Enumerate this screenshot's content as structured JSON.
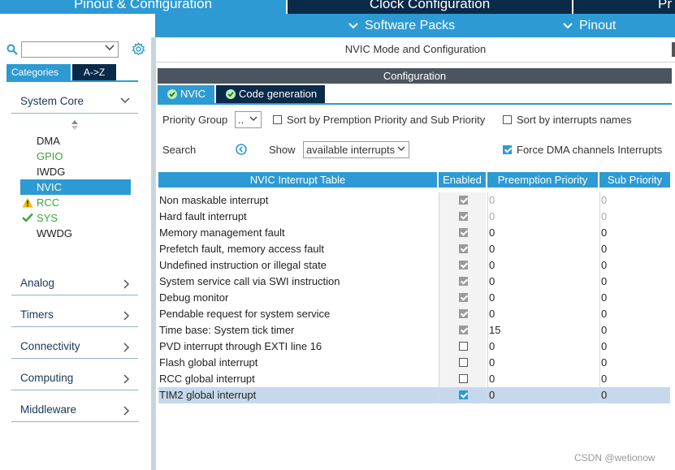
{
  "top_tabs": {
    "pinout": "Pinout & Configuration",
    "clock": "Clock Configuration",
    "project": "Pr"
  },
  "sub_bar": {
    "software_packs": "Software Packs",
    "pinout": "Pinout"
  },
  "left_panel": {
    "tabs": {
      "categories": "Categories",
      "atoz": "A->Z"
    },
    "system_core": {
      "label": "System Core",
      "items": [
        {
          "label": "DMA",
          "status": "none",
          "color": "#222222"
        },
        {
          "label": "GPIO",
          "status": "none",
          "color": "#3aa63a"
        },
        {
          "label": "IWDG",
          "status": "none",
          "color": "#222222"
        },
        {
          "label": "NVIC",
          "status": "selected",
          "color": "#ffffff"
        },
        {
          "label": "RCC",
          "status": "warning",
          "color": "#3aa63a"
        },
        {
          "label": "SYS",
          "status": "ok",
          "color": "#3aa63a"
        },
        {
          "label": "WWDG",
          "status": "none",
          "color": "#222222"
        }
      ]
    },
    "groups": [
      "Analog",
      "Timers",
      "Connectivity",
      "Computing",
      "Middleware"
    ]
  },
  "right_panel": {
    "mode_title": "NVIC Mode and Configuration",
    "config_title": "Configuration",
    "subtabs": {
      "nvic": "NVIC",
      "code_generation": "Code generation"
    },
    "priority_group_label": "Priority Group",
    "priority_group_value": "..",
    "sort_premption_label": "Sort by Premption Priority and Sub Priority",
    "sort_names_label": "Sort by interrupts names",
    "search_label": "Search",
    "show_label": "Show",
    "show_value": "available interrupts",
    "force_dma_label": "Force DMA channels Interrupts",
    "force_dma_checked": true
  },
  "table": {
    "headers": {
      "name": "NVIC Interrupt Table",
      "enabled": "Enabled",
      "preemption": "Preemption Priority",
      "sub": "Sub Priority"
    },
    "rows": [
      {
        "name": "Non maskable interrupt",
        "enabled": true,
        "locked": true,
        "preemption": "0",
        "sub": "0",
        "dim": true
      },
      {
        "name": "Hard fault interrupt",
        "enabled": true,
        "locked": true,
        "preemption": "0",
        "sub": "0",
        "dim": true
      },
      {
        "name": "Memory management fault",
        "enabled": true,
        "locked": true,
        "preemption": "0",
        "sub": "0",
        "dim": false
      },
      {
        "name": "Prefetch fault, memory access fault",
        "enabled": true,
        "locked": true,
        "preemption": "0",
        "sub": "0",
        "dim": false
      },
      {
        "name": "Undefined instruction or illegal state",
        "enabled": true,
        "locked": true,
        "preemption": "0",
        "sub": "0",
        "dim": false
      },
      {
        "name": "System service call via SWI instruction",
        "enabled": true,
        "locked": true,
        "preemption": "0",
        "sub": "0",
        "dim": false
      },
      {
        "name": "Debug monitor",
        "enabled": true,
        "locked": true,
        "preemption": "0",
        "sub": "0",
        "dim": false
      },
      {
        "name": "Pendable request for system service",
        "enabled": true,
        "locked": true,
        "preemption": "0",
        "sub": "0",
        "dim": false
      },
      {
        "name": "Time base: System tick timer",
        "enabled": true,
        "locked": true,
        "preemption": "15",
        "sub": "0",
        "dim": false
      },
      {
        "name": "PVD interrupt through EXTI line 16",
        "enabled": false,
        "locked": false,
        "preemption": "0",
        "sub": "0",
        "dim": false
      },
      {
        "name": "Flash global interrupt",
        "enabled": false,
        "locked": false,
        "preemption": "0",
        "sub": "0",
        "dim": false
      },
      {
        "name": "RCC global interrupt",
        "enabled": false,
        "locked": false,
        "preemption": "0",
        "sub": "0",
        "dim": false
      },
      {
        "name": "TIM2 global interrupt",
        "enabled": true,
        "locked": false,
        "preemption": "0",
        "sub": "0",
        "dim": false,
        "selected": true
      }
    ]
  },
  "watermark": "CSDN @wetionow",
  "colors": {
    "accent": "#2d9ad3",
    "dark": "#0a2a4a",
    "selected_row": "#c6d9ec"
  }
}
